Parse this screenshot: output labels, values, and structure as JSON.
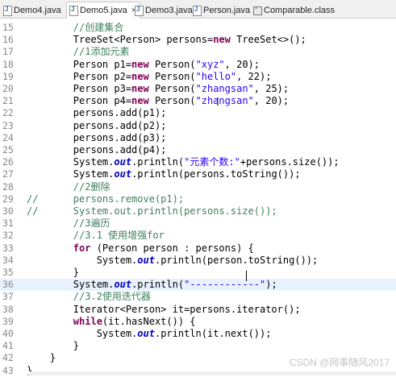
{
  "tabs": [
    {
      "label": "Demo4.java",
      "icon": "java-file-icon",
      "active": false
    },
    {
      "label": "Demo5.java",
      "icon": "java-file-icon",
      "active": true
    },
    {
      "label": "Demo3.java",
      "icon": "java-file-icon",
      "active": false
    },
    {
      "label": "Person.java",
      "icon": "java-file-icon",
      "active": false
    },
    {
      "label": "Comparable.class",
      "icon": "class-file-icon",
      "active": false
    }
  ],
  "close_glyph": "×",
  "lines": [
    {
      "n": "15",
      "tokens": [
        {
          "t": "        "
        },
        {
          "t": "//创建集合",
          "c": "cmt"
        }
      ]
    },
    {
      "n": "16",
      "tokens": [
        {
          "t": "        TreeSet<Person> persons="
        },
        {
          "t": "new",
          "c": "kw"
        },
        {
          "t": " TreeSet<>();"
        }
      ]
    },
    {
      "n": "17",
      "tokens": [
        {
          "t": "        "
        },
        {
          "t": "//1添加元素",
          "c": "cmt"
        }
      ]
    },
    {
      "n": "18",
      "tokens": [
        {
          "t": "        Person p1="
        },
        {
          "t": "new",
          "c": "kw"
        },
        {
          "t": " Person("
        },
        {
          "t": "\"xyz\"",
          "c": "str"
        },
        {
          "t": ", 20);"
        }
      ]
    },
    {
      "n": "19",
      "tokens": [
        {
          "t": "        Person p2="
        },
        {
          "t": "new",
          "c": "kw"
        },
        {
          "t": " Person("
        },
        {
          "t": "\"hello\"",
          "c": "str"
        },
        {
          "t": ", 22);"
        }
      ]
    },
    {
      "n": "20",
      "tokens": [
        {
          "t": "        Person p3="
        },
        {
          "t": "new",
          "c": "kw"
        },
        {
          "t": " Person("
        },
        {
          "t": "\"zhangsan\"",
          "c": "str"
        },
        {
          "t": ", 25);"
        }
      ]
    },
    {
      "n": "21",
      "tokens": [
        {
          "t": "        Person p4="
        },
        {
          "t": "new",
          "c": "kw"
        },
        {
          "t": " Person("
        },
        {
          "t": "\"zhangsan\"",
          "c": "str"
        },
        {
          "t": ", 20);"
        }
      ]
    },
    {
      "n": "22",
      "tokens": [
        {
          "t": "        persons.add(p1);"
        }
      ]
    },
    {
      "n": "23",
      "tokens": [
        {
          "t": "        persons.add(p2);"
        }
      ]
    },
    {
      "n": "24",
      "tokens": [
        {
          "t": "        persons.add(p3);"
        }
      ]
    },
    {
      "n": "25",
      "tokens": [
        {
          "t": "        persons.add(p4);"
        }
      ]
    },
    {
      "n": "26",
      "tokens": [
        {
          "t": "        System."
        },
        {
          "t": "out",
          "c": "fld"
        },
        {
          "t": ".println("
        },
        {
          "t": "\"元素个数:\"",
          "c": "str"
        },
        {
          "t": "+persons.size());"
        }
      ]
    },
    {
      "n": "27",
      "tokens": [
        {
          "t": "        System."
        },
        {
          "t": "out",
          "c": "fld"
        },
        {
          "t": ".println(persons.toString());"
        }
      ]
    },
    {
      "n": "28",
      "tokens": [
        {
          "t": "        "
        },
        {
          "t": "//2删除",
          "c": "cmt"
        }
      ]
    },
    {
      "n": "29",
      "tokens": [
        {
          "t": "//      persons.remove(p1);",
          "c": "cmt"
        }
      ]
    },
    {
      "n": "30",
      "tokens": [
        {
          "t": "//      System.out.println(persons.size());",
          "c": "cmt"
        }
      ]
    },
    {
      "n": "31",
      "tokens": [
        {
          "t": "        "
        },
        {
          "t": "//3遍历",
          "c": "cmt"
        }
      ]
    },
    {
      "n": "32",
      "tokens": [
        {
          "t": "        "
        },
        {
          "t": "//3.1 使用增强for",
          "c": "cmt"
        }
      ]
    },
    {
      "n": "33",
      "tokens": [
        {
          "t": "        "
        },
        {
          "t": "for",
          "c": "kw"
        },
        {
          "t": " (Person person : persons) {"
        }
      ]
    },
    {
      "n": "34",
      "tokens": [
        {
          "t": "            System."
        },
        {
          "t": "out",
          "c": "fld"
        },
        {
          "t": ".println(person.toString());"
        }
      ]
    },
    {
      "n": "35",
      "tokens": [
        {
          "t": "        }"
        }
      ]
    },
    {
      "n": "36",
      "tokens": [
        {
          "t": "        System."
        },
        {
          "t": "out",
          "c": "fld"
        },
        {
          "t": ".println("
        },
        {
          "t": "\"------------\"",
          "c": "str"
        },
        {
          "t": ");"
        }
      ],
      "highlight": true
    },
    {
      "n": "37",
      "tokens": [
        {
          "t": "        "
        },
        {
          "t": "//3.2使用迭代器",
          "c": "cmt"
        }
      ]
    },
    {
      "n": "38",
      "tokens": [
        {
          "t": "        Iterator<Person> it=persons.iterator();"
        }
      ]
    },
    {
      "n": "39",
      "tokens": [
        {
          "t": "        "
        },
        {
          "t": "while",
          "c": "kw"
        },
        {
          "t": "(it.hasNext()) {"
        }
      ]
    },
    {
      "n": "40",
      "tokens": [
        {
          "t": "            System."
        },
        {
          "t": "out",
          "c": "fld"
        },
        {
          "t": ".println(it.next());"
        }
      ]
    },
    {
      "n": "41",
      "tokens": [
        {
          "t": "        }"
        }
      ]
    },
    {
      "n": "42",
      "tokens": [
        {
          "t": "    }"
        }
      ]
    },
    {
      "n": "43",
      "tokens": [
        {
          "t": "}"
        }
      ]
    }
  ],
  "watermark": "CSDN @网事随风2017"
}
